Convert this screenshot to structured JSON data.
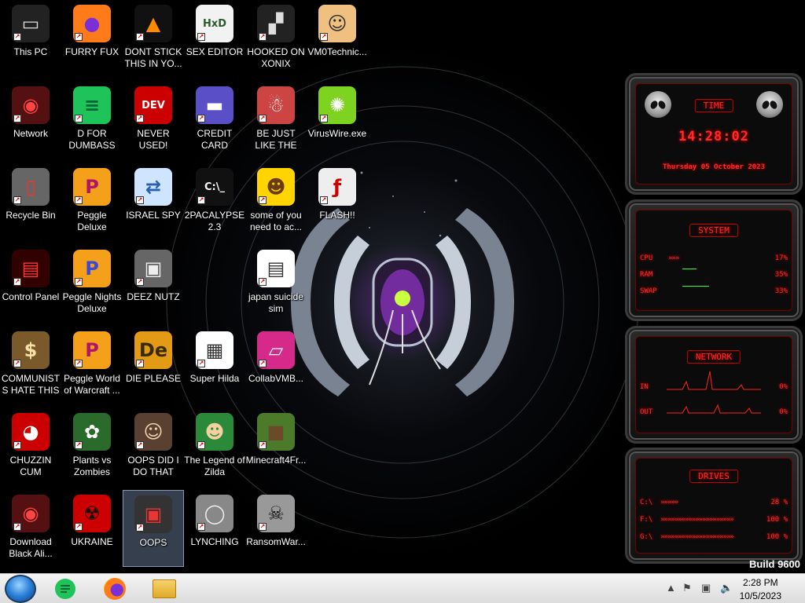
{
  "desktop": {
    "icons": [
      {
        "label": "This PC",
        "icon": "this-pc-icon"
      },
      {
        "label": "Network",
        "icon": "network-icon"
      },
      {
        "label": "Recycle Bin",
        "icon": "recycle-bin-icon"
      },
      {
        "label": "Control Panel",
        "icon": "control-panel-icon"
      },
      {
        "label": "COMMUNISTS HATE THIS G...",
        "icon": "money-bag-icon"
      },
      {
        "label": "CHUZZIN CUM",
        "icon": "chuzzle-icon"
      },
      {
        "label": "Download Black Ali...",
        "icon": "alien-ball-icon"
      },
      {
        "label": "FURRY FUX",
        "icon": "firefox-icon"
      },
      {
        "label": "D FOR DUMBASS",
        "icon": "d-app-icon"
      },
      {
        "label": "Peggle Deluxe",
        "icon": "peggle-icon"
      },
      {
        "label": "Peggle Nights Deluxe",
        "icon": "peggle-nights-icon"
      },
      {
        "label": "Peggle World of Warcraft ...",
        "icon": "peggle-wow-icon"
      },
      {
        "label": "Plants vs Zombies",
        "icon": "plants-vs-zombies-icon"
      },
      {
        "label": "UKRAINE",
        "icon": "radiation-icon"
      },
      {
        "label": "DONT STICK THIS IN YO...",
        "icon": "vlc-cone-icon"
      },
      {
        "label": "NEVER USED!",
        "icon": "dev-cpp-icon"
      },
      {
        "label": "ISRAEL SPY",
        "icon": "network-share-icon"
      },
      {
        "label": "DEEZ NUTZ",
        "icon": "stacked-windows-icon"
      },
      {
        "label": "DIE PLEASE",
        "icon": "de-app-icon"
      },
      {
        "label": "OOPS DID I DO THAT",
        "icon": "portrait-icon"
      },
      {
        "label": "OOPS",
        "icon": "oops-icon"
      },
      {
        "label": "SEX EDITOR",
        "icon": "hxd-icon"
      },
      {
        "label": "CREDIT CARD CHECKER",
        "icon": "credit-card-icon"
      },
      {
        "label": "2PACALYPSE 2.3",
        "icon": "console-icon"
      },
      {
        "label": "Super Hilda",
        "icon": "pixel-art-icon"
      },
      {
        "label": "The Legend of Zilda",
        "icon": "pixel-hero-icon"
      },
      {
        "label": "LYNCHING",
        "icon": "noose-icon"
      },
      {
        "label": "HOOKED ON XONIX",
        "icon": "xonix-icon"
      },
      {
        "label": "BE JUST LIKE THE DUDE!",
        "icon": "santa-icon"
      },
      {
        "label": "some of you need to ac...",
        "icon": "beaver-icon"
      },
      {
        "label": "japan suicide sim",
        "icon": "document-icon"
      },
      {
        "label": "CollabVMB...",
        "icon": "collabvm-icon"
      },
      {
        "label": "Minecraft4Fr...",
        "icon": "minecraft-grass-icon"
      },
      {
        "label": "RansomWar...",
        "icon": "skull-icon"
      },
      {
        "label": "VM0Technic...",
        "icon": "technician-icon"
      },
      {
        "label": "VirusWire.exe",
        "icon": "lime-icon"
      },
      {
        "label": "FLASH!!",
        "icon": "flash-icon"
      }
    ]
  },
  "gadgets": {
    "time": {
      "title": "TIME",
      "clock": "14:28:02",
      "date": "Thursday 05 October 2023"
    },
    "system": {
      "title": "SYSTEM",
      "rows": [
        {
          "key": "CPU",
          "chev": "»»»",
          "value": "17%"
        },
        {
          "key": "RAM",
          "chev": "",
          "value": "35%"
        },
        {
          "key": "SWAP",
          "chev": "",
          "value": "33%"
        }
      ]
    },
    "network": {
      "title": "NETWORK",
      "rows": [
        {
          "key": "IN",
          "value": "0%"
        },
        {
          "key": "OUT",
          "value": "0%"
        }
      ]
    },
    "drives": {
      "title": "DRIVES",
      "rows": [
        {
          "key": "C:\\",
          "chev": "»»»»»",
          "value": "28 %"
        },
        {
          "key": "F:\\",
          "chev": "»»»»»»»»»»»»»»»»»»»»»",
          "value": "100 %"
        },
        {
          "key": "G:\\",
          "chev": "»»»»»»»»»»»»»»»»»»»»»",
          "value": "100 %"
        }
      ]
    }
  },
  "overlay": {
    "build": "Build 9600"
  },
  "taskbar": {
    "pinned": [
      "start-orb",
      "d-app",
      "firefox",
      "file-explorer"
    ],
    "clock_time": "2:28 PM",
    "clock_date": "10/5/2023",
    "tray_icons": [
      "show-hidden-icon",
      "flag-icon",
      "network-tray-icon",
      "volume-icon"
    ]
  }
}
